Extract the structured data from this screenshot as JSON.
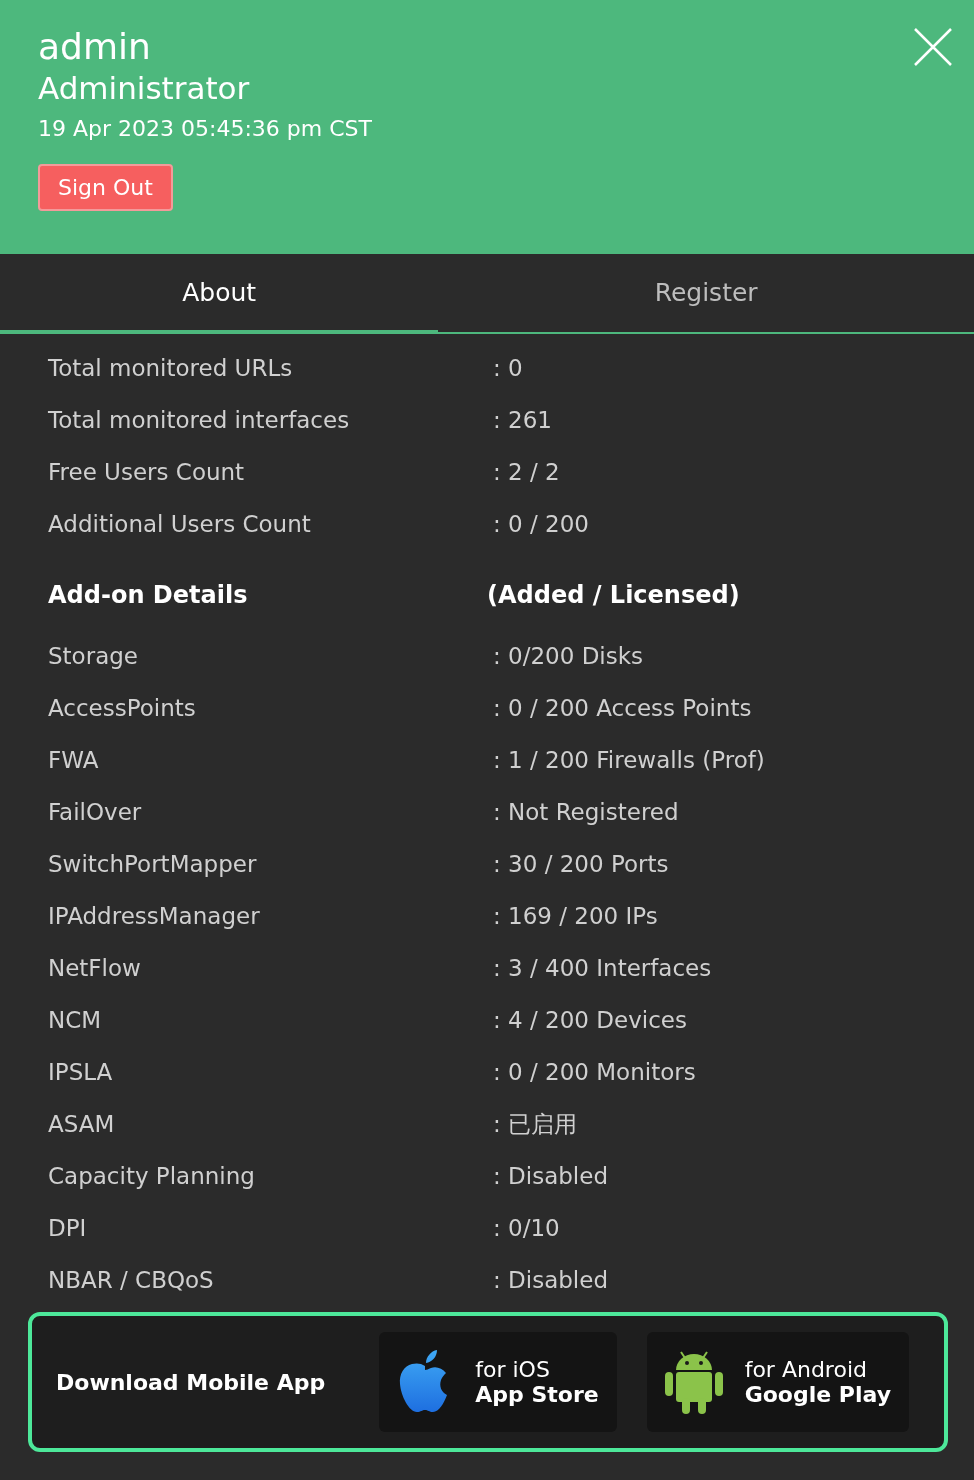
{
  "user": {
    "name": "admin",
    "role": "Administrator",
    "datetime": "19 Apr 2023 05:45:36 pm CST",
    "sign_out": "Sign Out"
  },
  "tabs": [
    {
      "label": "About",
      "selected": true
    },
    {
      "label": "Register",
      "selected": false
    }
  ],
  "summary": [
    {
      "label": "Total monitored URLs",
      "value": ": 0"
    },
    {
      "label": "Total monitored interfaces",
      "value": ": 261"
    },
    {
      "label": "Free Users Count",
      "value": ": 2 / 2"
    },
    {
      "label": "Additional Users Count",
      "value": ": 0 / 200"
    }
  ],
  "addons": {
    "heading": "Add-on Details",
    "heading_value": "(Added / Licensed)",
    "rows": [
      {
        "label": "Storage",
        "value": ": 0/200 Disks"
      },
      {
        "label": "AccessPoints",
        "value": ": 0 / 200 Access Points"
      },
      {
        "label": "FWA",
        "value": ": 1 / 200 Firewalls (Prof)"
      },
      {
        "label": "FailOver",
        "value": ": Not Registered"
      },
      {
        "label": "SwitchPortMapper",
        "value": ": 30 / 200 Ports"
      },
      {
        "label": "IPAddressManager",
        "value": ": 169 / 200 IPs"
      },
      {
        "label": "NetFlow",
        "value": ": 3 / 400 Interfaces"
      },
      {
        "label": "NCM",
        "value": ": 4 / 200 Devices"
      },
      {
        "label": "IPSLA",
        "value": ": 0 / 200 Monitors"
      },
      {
        "label": "ASAM",
        "value": ": 已启用"
      },
      {
        "label": "Capacity Planning",
        "value": ": Disabled"
      },
      {
        "label": "DPI",
        "value": ": 0/10"
      },
      {
        "label": "NBAR / CBQoS",
        "value": ": Disabled"
      }
    ]
  },
  "mobile_app": {
    "title": "Download Mobile App",
    "stores": [
      {
        "kind": "ios",
        "line1": "for iOS",
        "line2": "App Store"
      },
      {
        "kind": "android",
        "line1": "for Android",
        "line2": "Google Play"
      }
    ]
  }
}
